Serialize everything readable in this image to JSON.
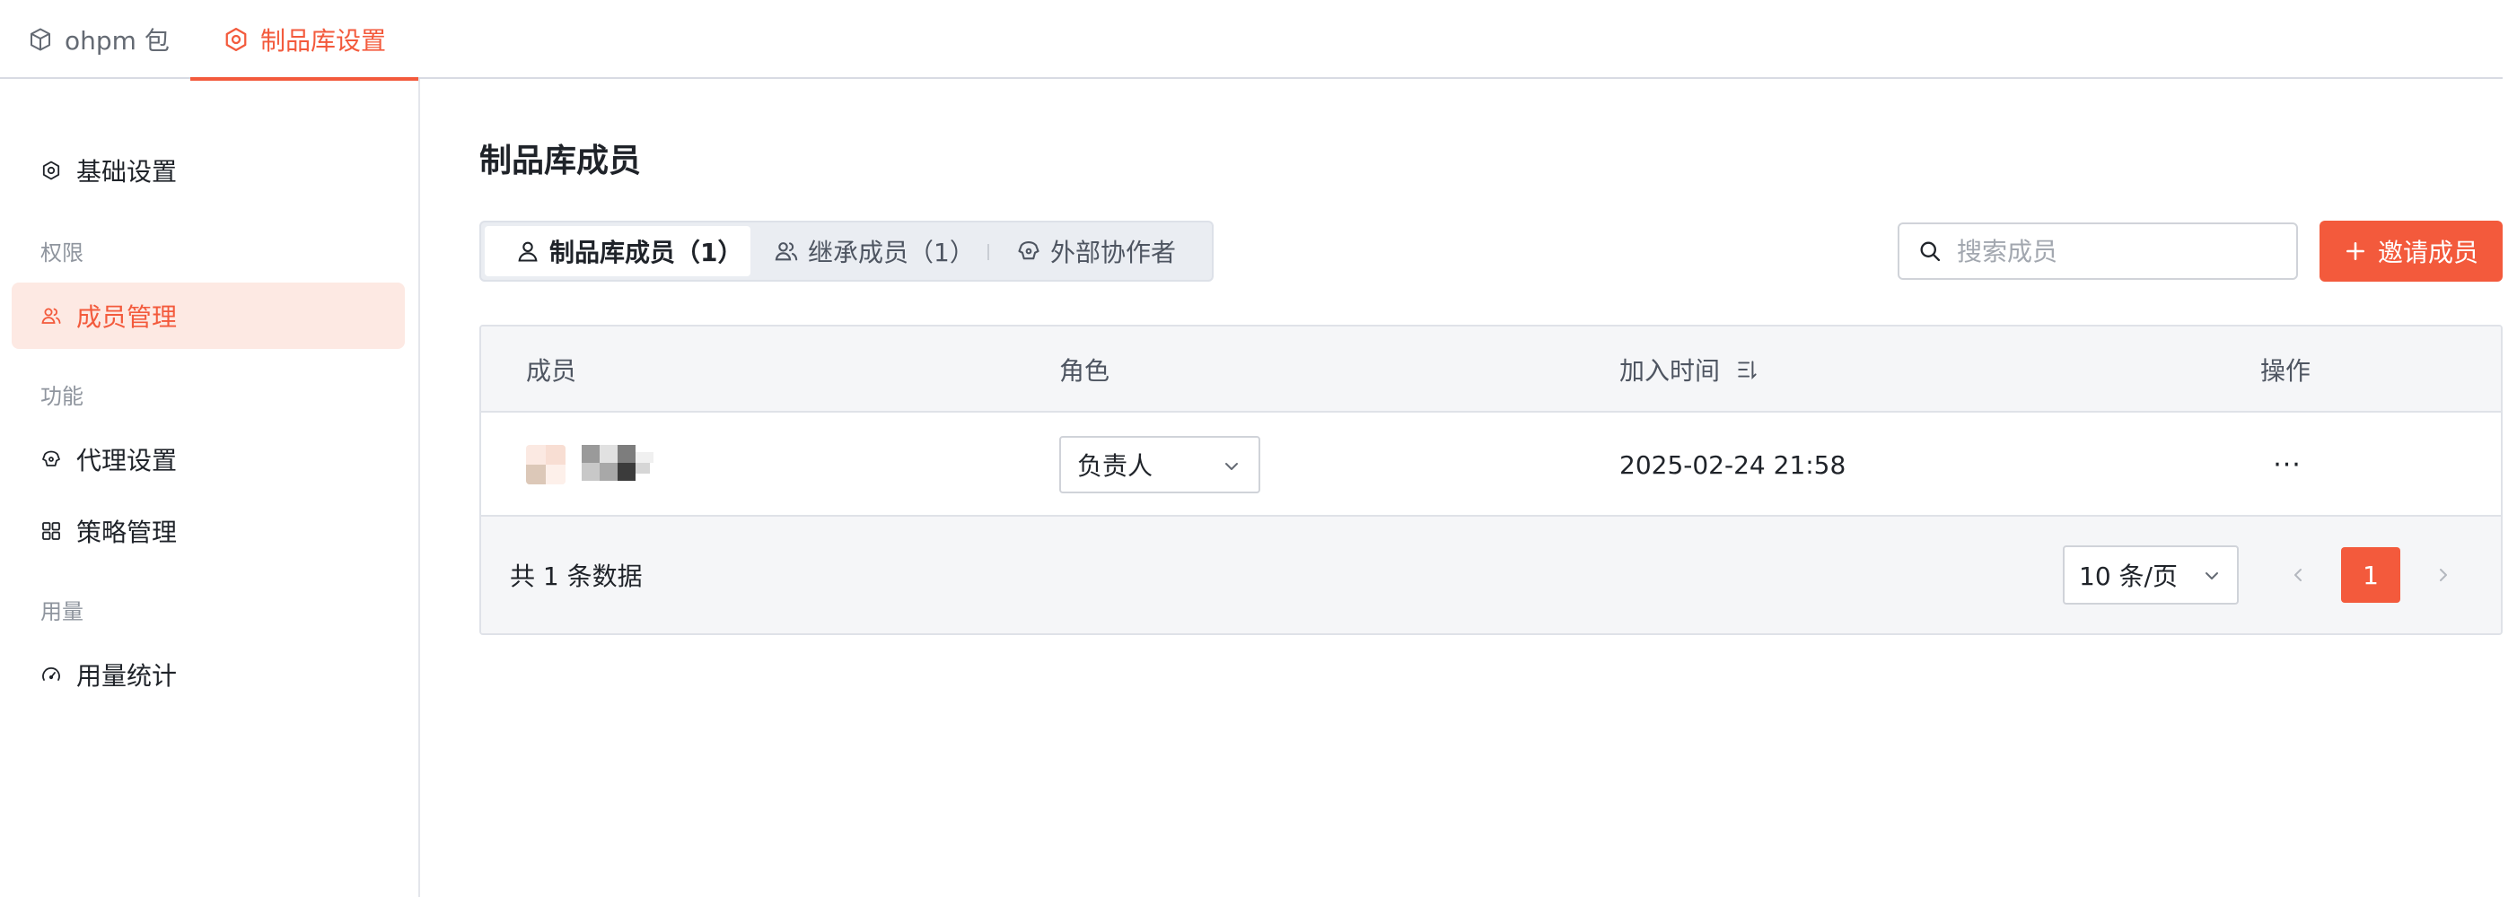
{
  "top_tabs": [
    {
      "label": "ohpm 包",
      "active": false,
      "icon": "package-icon"
    },
    {
      "label": "制品库设置",
      "active": true,
      "icon": "settings-icon"
    }
  ],
  "sidebar": {
    "basic": "基础设置",
    "group_permission": "权限",
    "members": "成员管理",
    "group_function": "功能",
    "proxy": "代理设置",
    "policy": "策略管理",
    "group_usage": "用量",
    "usage": "用量统计"
  },
  "page_title": "制品库成员",
  "segments": [
    {
      "label": "制品库成员（1）",
      "active": true
    },
    {
      "label": "继承成员（1）",
      "active": false
    },
    {
      "label": "外部协作者",
      "active": false
    }
  ],
  "search": {
    "placeholder": "搜索成员",
    "value": ""
  },
  "invite_label": "邀请成员",
  "table": {
    "headers": {
      "member": "成员",
      "role": "角色",
      "join_time": "加入时间",
      "actions": "操作"
    },
    "rows": [
      {
        "role": "负责人",
        "join_time": "2025-02-24 21:58",
        "more": "···"
      }
    ]
  },
  "footer": {
    "total": "共 1 条数据",
    "page_size": "10 条/页",
    "current_page": "1"
  },
  "colors": {
    "accent": "#f35a3c",
    "accent_light": "#fde9e3",
    "border": "#dfe2e8"
  }
}
